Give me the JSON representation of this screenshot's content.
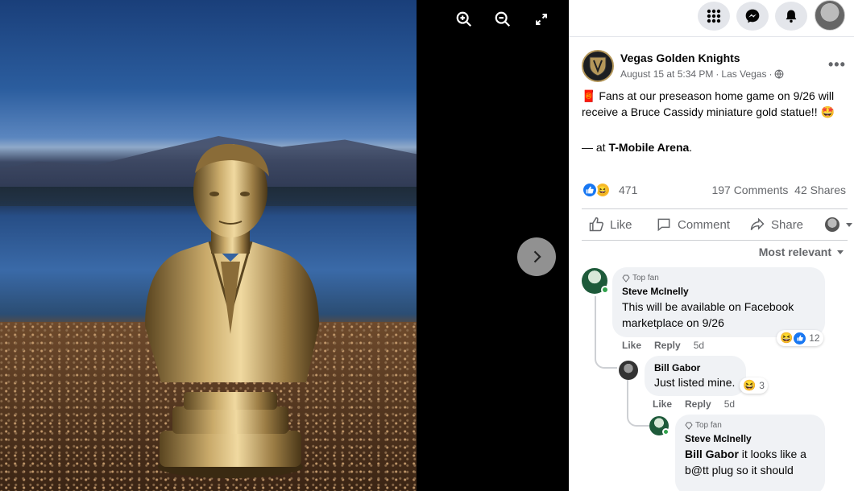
{
  "viewer": {
    "zoom_in_icon": "zoom-in-icon",
    "zoom_out_icon": "zoom-out-icon",
    "fullscreen_icon": "fullscreen-icon",
    "next_icon": "chevron-right-icon"
  },
  "post": {
    "page_name": "Vegas Golden Knights",
    "date": "August 15 at 5:34 PM",
    "separator": "·",
    "location_meta": "Las Vegas",
    "text": "🧧 Fans at our preseason home game on 9/26 will receive a Bruce Cassidy miniature gold statue!! 🤩",
    "at_prefix": "— at ",
    "location": "T-Mobile Arena",
    "location_suffix": ".",
    "reaction_count": "471",
    "comments": "197 Comments",
    "shares": "42 Shares"
  },
  "actions": {
    "like": "Like",
    "comment": "Comment",
    "share": "Share"
  },
  "sort_label": "Most relevant",
  "comments": [
    {
      "badge": "Top fan",
      "name": "Steve McInelly",
      "text": "This will be available on Facebook marketplace on 9/26",
      "reaction_count": "12",
      "like": "Like",
      "reply": "Reply",
      "time": "5d"
    },
    {
      "name": "Bill Gabor",
      "text": "Just listed mine.",
      "reaction_count": "3",
      "like": "Like",
      "reply": "Reply",
      "time": "5d"
    },
    {
      "badge": "Top fan",
      "name": "Steve McInelly",
      "mention": "Bill Gabor",
      "text": " it looks like a b@tt plug so it should"
    }
  ],
  "colors": {
    "facebook_blue": "#1877f2",
    "text_primary": "#050505",
    "text_secondary": "#65676b",
    "bubble_bg": "#f0f2f5",
    "gold": "#b4975a"
  }
}
